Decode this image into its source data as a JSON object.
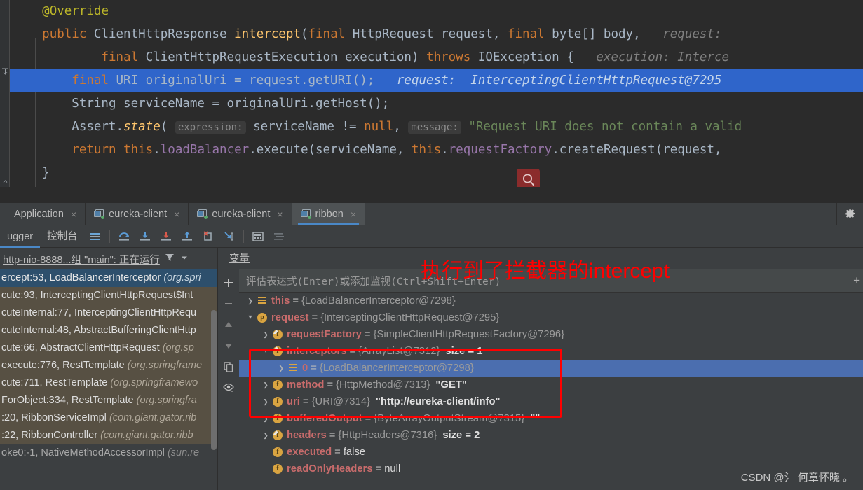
{
  "editor": {
    "lines": [
      {
        "id": "l1",
        "indent": 0,
        "highlight": false,
        "tokens": [
          {
            "t": "    ",
            "c": "id"
          },
          {
            "t": "@Override",
            "c": "anno"
          }
        ]
      },
      {
        "id": "l2",
        "indent": 0,
        "highlight": false,
        "tokens": [
          {
            "t": "    ",
            "c": "id"
          },
          {
            "t": "public",
            "c": "kw"
          },
          {
            "t": " ClientHttpResponse ",
            "c": "id"
          },
          {
            "t": "intercept",
            "c": "mth"
          },
          {
            "t": "(",
            "c": "id"
          },
          {
            "t": "final",
            "c": "kw"
          },
          {
            "t": " HttpRequest request, ",
            "c": "id"
          },
          {
            "t": "final",
            "c": "kw"
          },
          {
            "t": " byte[] body,",
            "c": "id"
          },
          {
            "t": "   request:",
            "c": "hint"
          }
        ]
      },
      {
        "id": "l3",
        "indent": 0,
        "highlight": false,
        "tokens": [
          {
            "t": "            ",
            "c": "id"
          },
          {
            "t": "final",
            "c": "kw"
          },
          {
            "t": " ClientHttpRequestExecution execution) ",
            "c": "id"
          },
          {
            "t": "throws",
            "c": "kw"
          },
          {
            "t": " IOException {",
            "c": "id"
          },
          {
            "t": "   execution: Interce",
            "c": "hint"
          }
        ]
      },
      {
        "id": "l4",
        "indent": 0,
        "highlight": true,
        "tokens": [
          {
            "t": "        ",
            "c": "id"
          },
          {
            "t": "final",
            "c": "kw"
          },
          {
            "t": " URI originalUri = request.getURI();",
            "c": "id"
          },
          {
            "t": "   request:  InterceptingClientHttpRequest@7295",
            "c": "hint"
          }
        ]
      },
      {
        "id": "l5",
        "indent": 0,
        "highlight": false,
        "tokens": [
          {
            "t": "        String serviceName = originalUri.getHost();",
            "c": "id"
          }
        ]
      },
      {
        "id": "l6",
        "indent": 0,
        "highlight": false,
        "tokens": [
          {
            "t": "        Assert.",
            "c": "id"
          },
          {
            "t": "state",
            "c": "mth-i"
          },
          {
            "t": "( ",
            "c": "id"
          },
          {
            "t": "expression:",
            "c": "badge"
          },
          {
            "t": " serviceName != ",
            "c": "id"
          },
          {
            "t": "null",
            "c": "kw"
          },
          {
            "t": ", ",
            "c": "id"
          },
          {
            "t": "message:",
            "c": "badge"
          },
          {
            "t": " \"Request URI does not contain a valid",
            "c": "str"
          }
        ]
      },
      {
        "id": "l7",
        "indent": 0,
        "highlight": false,
        "tokens": [
          {
            "t": "        ",
            "c": "id"
          },
          {
            "t": "return",
            "c": "kw"
          },
          {
            "t": " ",
            "c": "id"
          },
          {
            "t": "this",
            "c": "kw"
          },
          {
            "t": ".",
            "c": "id"
          },
          {
            "t": "loadBalancer",
            "c": "fld"
          },
          {
            "t": ".execute(serviceName, ",
            "c": "id"
          },
          {
            "t": "this",
            "c": "kw"
          },
          {
            "t": ".",
            "c": "id"
          },
          {
            "t": "requestFactory",
            "c": "fld"
          },
          {
            "t": ".createRequest(request,",
            "c": "id"
          }
        ]
      },
      {
        "id": "l8",
        "indent": 0,
        "highlight": false,
        "tokens": [
          {
            "t": "    }",
            "c": "id"
          }
        ]
      }
    ],
    "magnifier_icon": "search-icon"
  },
  "tabbar": {
    "tabs": [
      {
        "label": "Application",
        "icon": "run-config-icon",
        "active": false,
        "close": "×"
      },
      {
        "label": "eureka-client",
        "icon": "run-config-icon",
        "active": false,
        "close": "×"
      },
      {
        "label": "eureka-client",
        "icon": "run-config-icon",
        "active": false,
        "close": "×"
      },
      {
        "label": "ribbon",
        "icon": "run-config-icon",
        "active": true,
        "close": "×"
      }
    ],
    "settings_icon": "gear-icon"
  },
  "debug_toolbar": {
    "tabs": [
      {
        "label": "ugger",
        "active": true
      },
      {
        "label": "控制台",
        "active": false
      }
    ],
    "buttons": [
      {
        "name": "frames-icon",
        "title": "Frames"
      },
      {
        "name": "step-over-icon",
        "title": "Step Over"
      },
      {
        "name": "step-into-icon",
        "title": "Step Into"
      },
      {
        "name": "force-step-into-icon",
        "title": "Force Step Into"
      },
      {
        "name": "step-out-icon",
        "title": "Step Out"
      },
      {
        "name": "drop-frame-icon",
        "title": "Drop Frame"
      },
      {
        "name": "run-to-cursor-icon",
        "title": "Run to Cursor"
      },
      {
        "name": "evaluate-expression-icon",
        "title": "Evaluate Expression"
      },
      {
        "name": "settings-list-icon",
        "title": "Layout Settings"
      }
    ]
  },
  "frames": {
    "thread_label": "http-nio-8888...组 \"main\": 正在运行",
    "filter_icon": "filter-icon",
    "dropdown_icon": "chevron-down-icon",
    "rows": [
      {
        "text": "ercept:53, LoadBalancerInterceptor ",
        "pkg": "(org.spri",
        "style": "sel"
      },
      {
        "text": "cute:93, InterceptingClientHttpRequest$Int",
        "pkg": "",
        "style": "mine"
      },
      {
        "text": "cuteInternal:77, InterceptingClientHttpRequ",
        "pkg": "",
        "style": "mine"
      },
      {
        "text": "cuteInternal:48, AbstractBufferingClientHttp",
        "pkg": "",
        "style": "mine"
      },
      {
        "text": "cute:66, AbstractClientHttpRequest ",
        "pkg": "(org.sp",
        "style": "mine"
      },
      {
        "text": "execute:776, RestTemplate ",
        "pkg": "(org.springframe",
        "style": "mine"
      },
      {
        "text": "cute:711, RestTemplate ",
        "pkg": "(org.springframewo",
        "style": "mine"
      },
      {
        "text": "ForObject:334, RestTemplate ",
        "pkg": "(org.springfra",
        "style": "mine"
      },
      {
        "text": ":20, RibbonServiceImpl ",
        "pkg": "(com.giant.gator.rib",
        "style": "mine2"
      },
      {
        "text": ":22, RibbonController ",
        "pkg": "(com.giant.gator.ribb",
        "style": "mine2"
      },
      {
        "text": "oke0:-1, NativeMethodAccessorImpl ",
        "pkg": "(sun.re",
        "style": "plain"
      }
    ]
  },
  "variables": {
    "title": "变量",
    "eval_placeholder": "评估表达式(Enter)或添加监视(Ctrl+Shift+Enter)",
    "add_label": "+",
    "toolbar": [
      {
        "name": "add-watch-icon",
        "glyph": "+"
      },
      {
        "name": "remove-watch-icon",
        "glyph": "−"
      },
      {
        "name": "move-up-icon",
        "glyph": "▲"
      },
      {
        "name": "move-down-icon",
        "glyph": "▼"
      },
      {
        "name": "copy-value-icon",
        "glyph": "❐"
      },
      {
        "name": "watch-eye-icon",
        "glyph": "◉"
      }
    ],
    "rows": [
      {
        "indent": 0,
        "arrow": "›",
        "icon": "obj",
        "name": "this",
        "eq": "=",
        "ref": "{LoadBalancerInterceptor@7298}",
        "val": "",
        "sel": false
      },
      {
        "indent": 0,
        "arrow": "∨",
        "icon": "p",
        "name": "request",
        "eq": "=",
        "ref": "{InterceptingClientHttpRequest@7295}",
        "val": "",
        "sel": false
      },
      {
        "indent": 1,
        "arrow": "›",
        "icon": "f-final",
        "name": "requestFactory",
        "eq": "=",
        "ref": "{SimpleClientHttpRequestFactory@7296}",
        "val": "",
        "sel": false
      },
      {
        "indent": 1,
        "arrow": "∨",
        "icon": "f-final",
        "name": "interceptors",
        "eq": "=",
        "ref": "{ArrayList@7312}",
        "val": "size = 1",
        "sel": false
      },
      {
        "indent": 2,
        "arrow": "›",
        "icon": "obj",
        "name": "0",
        "eq": "=",
        "ref": "{LoadBalancerInterceptor@7298}",
        "val": "",
        "sel": true
      },
      {
        "indent": 1,
        "arrow": "›",
        "icon": "f",
        "name": "method",
        "eq": "=",
        "ref": "{HttpMethod@7313}",
        "val": "\"GET\"",
        "sel": false
      },
      {
        "indent": 1,
        "arrow": "›",
        "icon": "f",
        "name": "uri",
        "eq": "=",
        "ref": "{URI@7314}",
        "val": "\"http://eureka-client/info\"",
        "sel": false
      },
      {
        "indent": 1,
        "arrow": "›",
        "icon": "f",
        "name": "bufferedOutput",
        "eq": "=",
        "ref": "{ByteArrayOutputStream@7315}",
        "val": "\"\"",
        "sel": false
      },
      {
        "indent": 1,
        "arrow": "›",
        "icon": "f-final",
        "name": "headers",
        "eq": "=",
        "ref": "{HttpHeaders@7316}",
        "val": "size = 2",
        "sel": false
      },
      {
        "indent": 1,
        "arrow": "",
        "icon": "f",
        "name": "executed",
        "eq": "=",
        "ref": "",
        "val": "false",
        "plain": true,
        "sel": false
      },
      {
        "indent": 1,
        "arrow": "",
        "icon": "f",
        "name": "readOnlyHeaders",
        "eq": "=",
        "ref": "",
        "val": "null",
        "plain": true,
        "sel": false
      }
    ]
  },
  "annotations": {
    "red_text": "执行到了拦截器的intercept",
    "red_box_color": "#ff0000",
    "watermark": "CSDN @氵 何章怀晓 。"
  }
}
